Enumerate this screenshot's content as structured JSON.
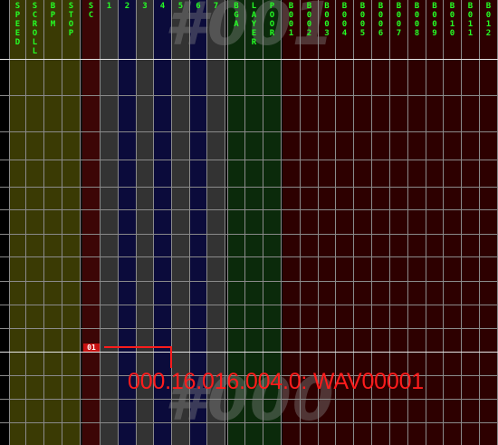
{
  "colors": {
    "green_header_text": "#25ff25",
    "control_column_bg": "#3a3a04",
    "scratch_column_bg": "#3c0606",
    "key_light_bg": "#333333",
    "key_dark_bg": "#0b0b3b",
    "bga_column_bg": "#0b2a0b",
    "bgm_column_bg": "#2d0000",
    "note_color": "#ff1c1c",
    "watermark_color": "#8c8c8c"
  },
  "columns": {
    "speed": "SPEED",
    "scroll": "SCROLL",
    "bpm": "BPM",
    "stop": "STOP",
    "scratch": "SC",
    "key1": "1",
    "key2": "2",
    "key3": "3",
    "key4": "4",
    "key5": "5",
    "key6": "6",
    "key7": "7",
    "bga": "BGA",
    "layer": "LAYER",
    "poor": "POOR",
    "bgm": [
      "B001",
      "B002",
      "B003",
      "B004",
      "B005",
      "B006",
      "B007",
      "B008",
      "B009",
      "B010",
      "B011",
      "B012"
    ]
  },
  "measures": {
    "upper": "#001",
    "lower": "#000"
  },
  "selected_note": {
    "tag": "01",
    "info": "000.16.016.004.0: WAV00001"
  }
}
